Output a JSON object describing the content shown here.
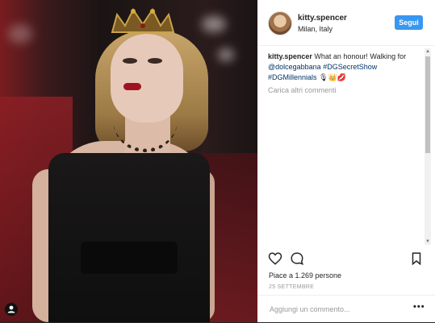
{
  "post": {
    "username": "kitty.spencer",
    "location": "Milan, Italy",
    "follow_label": "Segui",
    "caption": {
      "username": "kitty.spencer",
      "text_before": "What an honour! Walking for",
      "mention": "@dolcegabbana",
      "tag1": "#DGSecretShow",
      "tag2": "#DGMillennials",
      "emoji": "🎙👑💋"
    },
    "load_more_label": "Carica altri commenti",
    "likes_text": "Piace a 1.269 persone",
    "date": "25 SETTEMBRE",
    "add_comment_placeholder": "Aggiungi un commento...",
    "more_options": "•••"
  },
  "icons": {
    "like": "heart-icon",
    "comment": "comment-bubble-icon",
    "save": "bookmark-icon",
    "photo_tag": "person-tag-icon"
  },
  "colors": {
    "follow_button": "#3897f0",
    "link": "#003569",
    "muted": "#999999"
  }
}
